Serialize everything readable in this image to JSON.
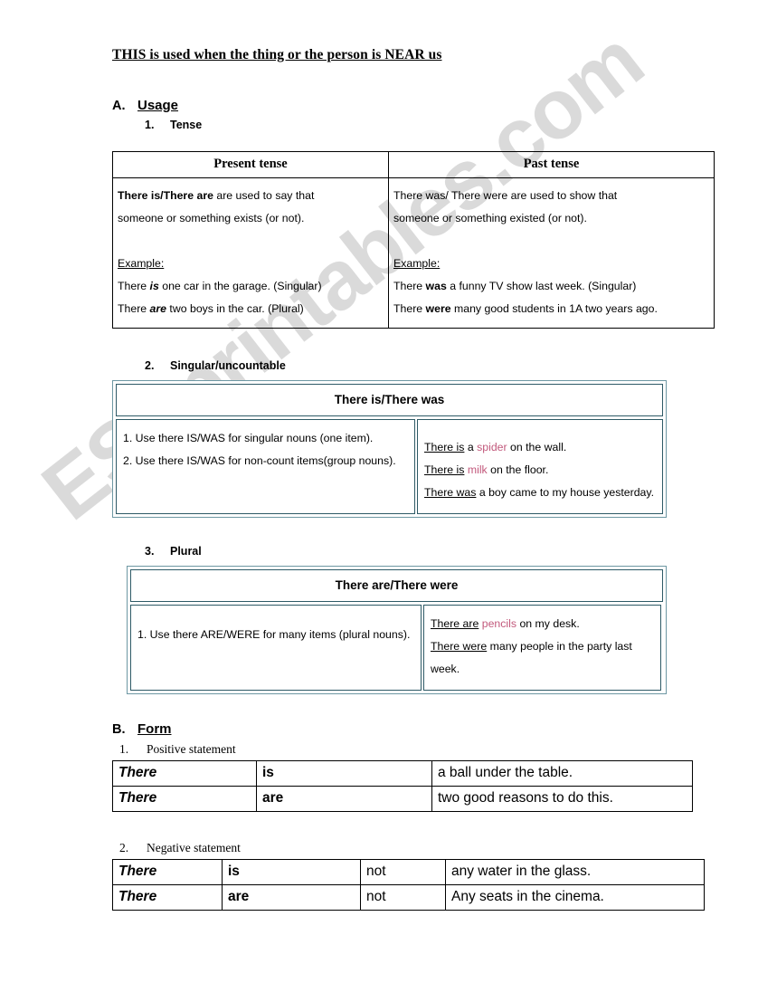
{
  "watermark": {
    "text": "ESLprintables.com"
  },
  "document": {
    "title": "THIS is used when the thing or the person is NEAR us"
  },
  "sections": {
    "a": {
      "letter": "A.",
      "title": "Usage",
      "sub1": {
        "number": "1.",
        "label": "Tense"
      },
      "sub2": {
        "number": "2.",
        "label": "Singular/uncountable"
      },
      "sub3": {
        "number": "3.",
        "label": "Plural"
      }
    },
    "b": {
      "letter": "B.",
      "title": "Form",
      "sub1": {
        "number": "1.",
        "label": "Positive statement"
      },
      "sub2": {
        "number": "2.",
        "label": "Negative statement"
      }
    }
  },
  "tense_table": {
    "headers": [
      "Present tense",
      "Past tense"
    ],
    "present": {
      "rule_bold": "There is/There are",
      "rule_rest": " are used to say that",
      "rule_line2": "someone or something exists (or not).",
      "example_label": "Example:",
      "example1_pre": "There ",
      "example1_bold": "is",
      "example1_post": " one car in the garage. (Singular)",
      "example2_pre": "There ",
      "example2_bold": "are",
      "example2_post": " two boys in the car. (Plural)"
    },
    "past": {
      "rule_line1": "There was/ There were are used to show that",
      "rule_line2": "someone or something existed (or not).",
      "example_label": "Example:",
      "example1_pre": "There ",
      "example1_bold": "was",
      "example1_post": " a funny TV show last week.    (Singular)",
      "example2_pre": "There ",
      "example2_bold": "were",
      "example2_post": " many good students in 1A two years ago."
    }
  },
  "singular_box": {
    "header": "There is/There was",
    "rules": [
      "1. Use there IS/WAS for singular nouns (one item).",
      "2. Use there IS/WAS for non-count items(group nouns)."
    ],
    "examples": [
      {
        "lead": "There is",
        "mid": " a ",
        "highlight": "spider",
        "tail": " on the wall."
      },
      {
        "lead": "There is",
        "mid": " ",
        "highlight": "milk",
        "tail": " on the floor."
      },
      {
        "lead": "There was",
        "mid": "",
        "highlight": "",
        "tail": " a boy came to my house yesterday."
      }
    ]
  },
  "plural_box": {
    "header": "There are/There were",
    "rules": [
      "1.   Use there ARE/WERE for many items (plural nouns)."
    ],
    "examples": [
      {
        "lead": "There are",
        "mid": " ",
        "highlight": "pencils",
        "tail": " on my desk."
      },
      {
        "lead": "There were",
        "mid": "",
        "highlight": "",
        "tail": " many people in the party last week."
      }
    ]
  },
  "positive_table": {
    "rows": [
      {
        "subject": "There",
        "verb": "is",
        "complement": "a ball under the table."
      },
      {
        "subject": "There",
        "verb": "are",
        "complement": "two good reasons to do this."
      }
    ]
  },
  "negative_table": {
    "rows": [
      {
        "subject": "There",
        "verb": "is",
        "negation": "not",
        "complement": "any water in the glass."
      },
      {
        "subject": "There",
        "verb": "are",
        "negation": "not",
        "complement": "Any seats in the cinema."
      }
    ]
  },
  "colors": {
    "highlight": "#c2597c",
    "teal_border": "#2e5a66",
    "teal_outer": "#6d97a3",
    "watermark": "#d2d2d2"
  }
}
